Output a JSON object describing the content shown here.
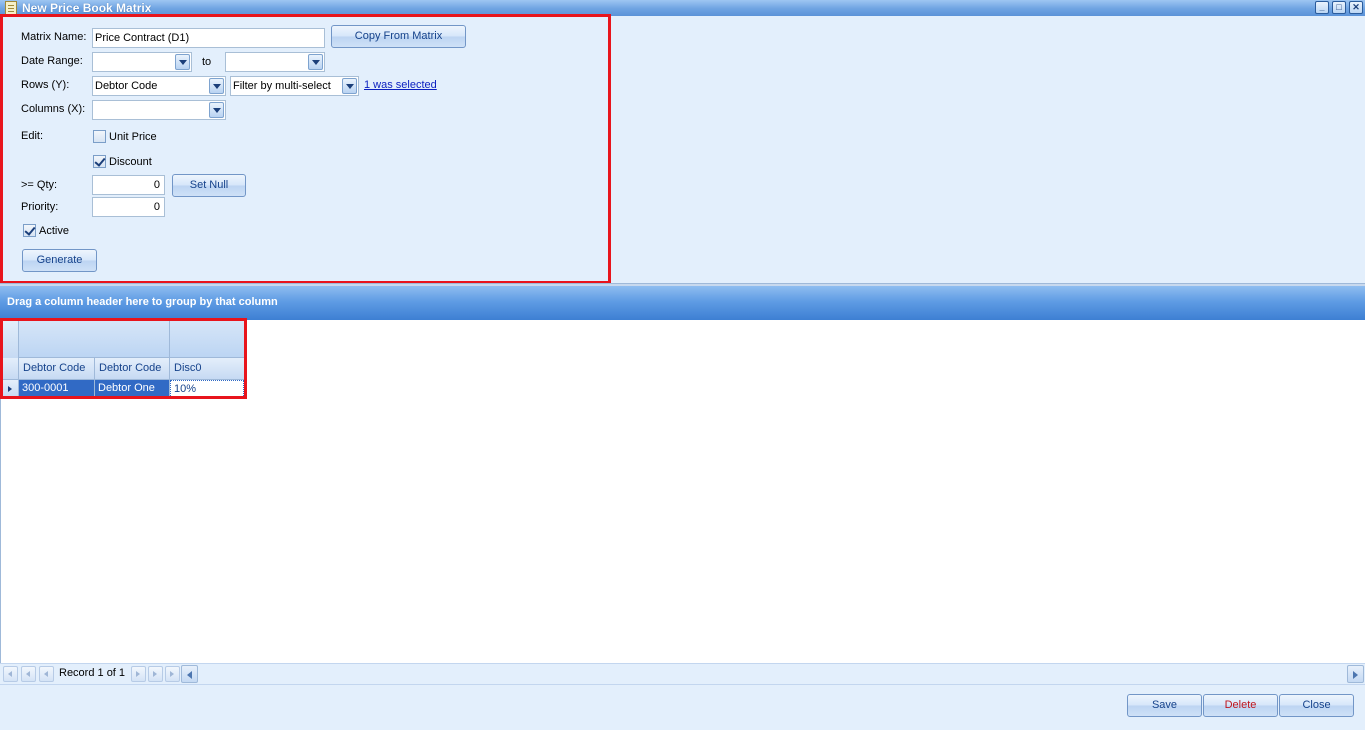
{
  "window": {
    "title": "New Price Book Matrix",
    "controls": {
      "minimize": "_",
      "maximize": "□",
      "close": "✕"
    }
  },
  "form": {
    "matrix_name_label": "Matrix Name:",
    "matrix_name_value": "Price Contract (D1)",
    "copy_button": "Copy From Matrix",
    "date_range_label": "Date Range:",
    "date_from": "",
    "date_to_label": "to",
    "date_to": "",
    "rows_label": "Rows (Y):",
    "rows_value": "Debtor Code",
    "rows_filter_value": "Filter by multi-select",
    "rows_selected_link": "1 was selected",
    "columns_label": "Columns (X):",
    "columns_value": "",
    "edit_label": "Edit:",
    "unit_price_label": "Unit Price",
    "unit_price_checked": false,
    "discount_label": "Discount",
    "discount_checked": true,
    "qty_label": ">= Qty:",
    "qty_value": "0",
    "set_null_button": "Set Null",
    "priority_label": "Priority:",
    "priority_value": "0",
    "active_label": "Active",
    "active_checked": true,
    "generate_button": "Generate"
  },
  "grid": {
    "group_panel_text": "Drag a column header here to group by that column",
    "columns": [
      "Debtor Code",
      "Debtor Code",
      "Disc0"
    ],
    "rows": [
      [
        "300-0001",
        "Debtor One",
        "10%"
      ]
    ]
  },
  "navigator": {
    "record_text": "Record 1 of 1"
  },
  "actions": {
    "save": "Save",
    "delete": "Delete",
    "close": "Close"
  },
  "colors": {
    "highlight": "#e8141c",
    "selection": "#316ac5",
    "background": "#e3effc"
  }
}
